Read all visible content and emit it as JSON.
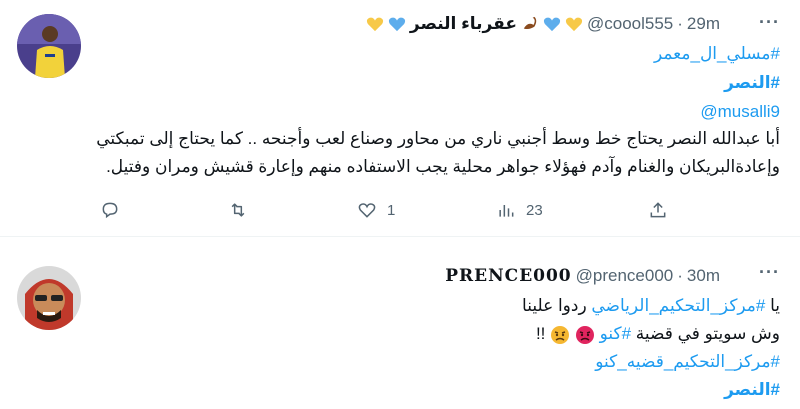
{
  "tweet1": {
    "display_name": "عقرباء النصر",
    "handle": "@coool555",
    "dot": "·",
    "time": "29m",
    "more": "···",
    "lines": [
      "#مسلي_ال_معمر",
      "#النصر",
      "@musalli9",
      "أبا عبدالله النصر يحتاج خط وسط أجنبي ناري من محاور وصناع لعب وأجنحه .. كما يحتاج إلى تمبكتي",
      "وإعادةالبريكان والغنام وآدم فهؤلاء جواهر محلية يجب الاستفاده منهم وإعارة قشيش ومران وفتيل."
    ],
    "counts": {
      "reply": "",
      "retweet": "",
      "like": "1",
      "views": "23"
    },
    "icons": [
      "reply-icon",
      "retweet-icon",
      "like-icon",
      "views-icon",
      "share-icon"
    ]
  },
  "tweet2": {
    "display_name": "PRENCE000",
    "handle": "@prence000",
    "dot": "·",
    "time": "30m",
    "more": "···",
    "line1_pre": "يا ",
    "line1_tag": "#مركز_التحكيم_الرياضي",
    "line1_post": " ردوا علينا",
    "line2_pre": "وش سويتو في قضية ",
    "line2_tag": "#كنو",
    "line2_post": " !!",
    "line3": "#مركز_التحكيم_قضيه_كنو",
    "line4": "#النصر"
  },
  "colors": {
    "link": "#1d9bf0",
    "muted": "#536471",
    "gold_heart": "#f7c948",
    "blue_heart": "#5dadec"
  }
}
